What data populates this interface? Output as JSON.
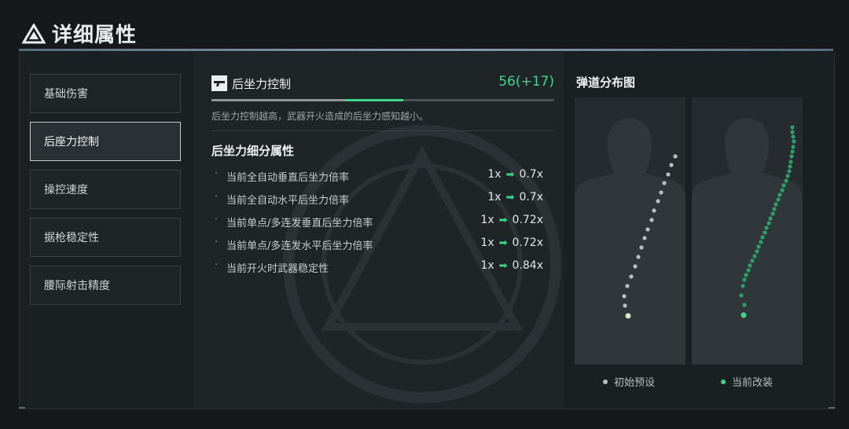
{
  "header": {
    "title": "详细属性"
  },
  "nav": {
    "items": [
      {
        "label": "基础伤害",
        "active": false
      },
      {
        "label": "后座力控制",
        "active": true
      },
      {
        "label": "操控速度",
        "active": false
      },
      {
        "label": "据枪稳定性",
        "active": false
      },
      {
        "label": "腰际射击精度",
        "active": false
      }
    ]
  },
  "stat": {
    "icon": "gun-icon",
    "name": "后坐力控制",
    "value": "56(+17)",
    "base_fraction": 0.39,
    "bonus_fraction": 0.17,
    "description": "后坐力控制越高，武器开火造成的后坐力感知越小。"
  },
  "detail": {
    "title": "后坐力细分属性",
    "rows": [
      {
        "bullet": "·",
        "label": "当前全自动垂直后坐力倍率",
        "from": "1x",
        "to": "0.7x"
      },
      {
        "bullet": "·",
        "label": "当前全自动水平后坐力倍率",
        "from": "1x",
        "to": "0.7x"
      },
      {
        "bullet": "·",
        "label": "当前单点/多连发垂直后坐力倍率",
        "from": "1x",
        "to": "0.72x"
      },
      {
        "bullet": "·",
        "label": "当前单点/多连发水平后坐力倍率",
        "from": "1x",
        "to": "0.72x"
      },
      {
        "bullet": "·",
        "label": "当前开火时武器稳定性",
        "from": "1x",
        "to": "0.84x"
      }
    ],
    "arrow": "➡"
  },
  "ballistics": {
    "title": "弹道分布图",
    "legend_initial": "初始预设",
    "legend_current": "当前改装",
    "color_initial": "#b9bfc2",
    "color_current": "#3ed68c"
  },
  "colors": {
    "accent": "#3ed68c",
    "bg": "#15191c"
  }
}
